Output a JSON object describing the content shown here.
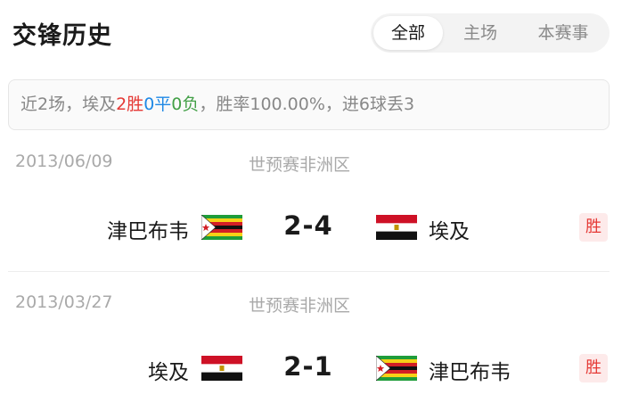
{
  "header": {
    "title": "交锋历史",
    "tabs": [
      {
        "label": "全部",
        "active": true
      },
      {
        "label": "主场",
        "active": false
      },
      {
        "label": "本赛事",
        "active": false
      }
    ]
  },
  "summary": {
    "prefix": "近2场，埃及",
    "wins": "2胜",
    "draws": "0平",
    "losses": "0负",
    "suffix": "，胜率100.00%，进6球丢3"
  },
  "matches": [
    {
      "date": "2013/06/09",
      "competition": "世预赛非洲区",
      "home": {
        "name": "津巴布韦",
        "flag": "zimbabwe-flag"
      },
      "score": "2-4",
      "away": {
        "name": "埃及",
        "flag": "egypt-flag"
      },
      "result": "胜"
    },
    {
      "date": "2013/03/27",
      "competition": "世预赛非洲区",
      "home": {
        "name": "埃及",
        "flag": "egypt-flag"
      },
      "score": "2-1",
      "away": {
        "name": "津巴布韦",
        "flag": "zimbabwe-flag"
      },
      "result": "胜"
    }
  ],
  "colors": {
    "win": "#e53935",
    "draw": "#1e88e5",
    "loss": "#43a047",
    "muted": "#a9a9a9"
  }
}
